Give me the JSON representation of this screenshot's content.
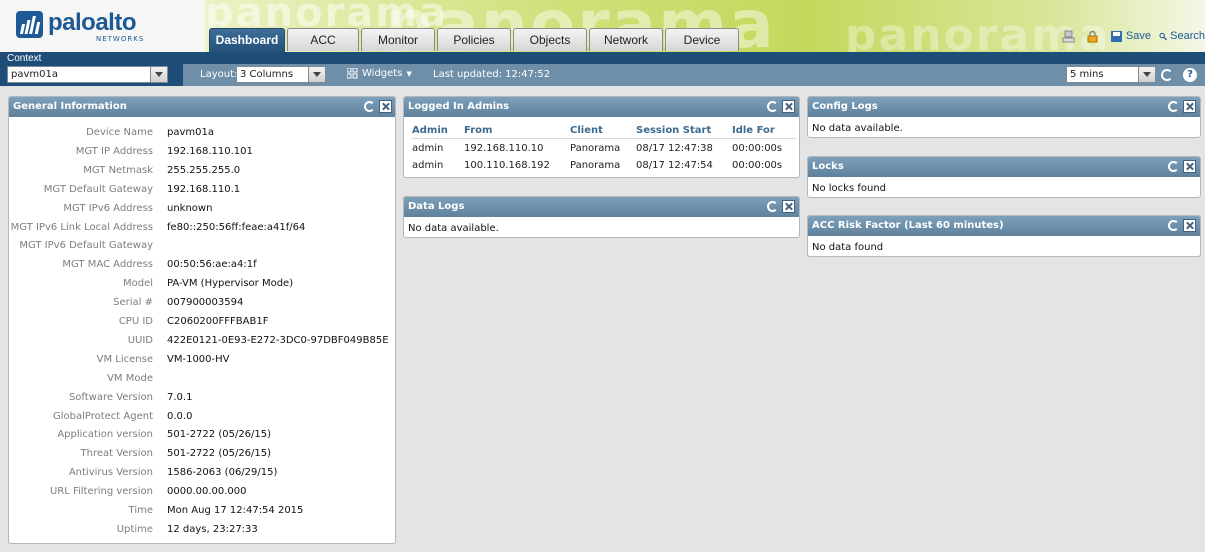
{
  "brand": {
    "name": "paloalto",
    "sub": "NETWORKS",
    "watermark": "panorama"
  },
  "tabs": [
    {
      "label": "Dashboard",
      "active": true
    },
    {
      "label": "ACC",
      "active": false
    },
    {
      "label": "Monitor",
      "active": false
    },
    {
      "label": "Policies",
      "active": false
    },
    {
      "label": "Objects",
      "active": false
    },
    {
      "label": "Network",
      "active": false
    },
    {
      "label": "Device",
      "active": false
    }
  ],
  "header_actions": {
    "save_label": "Save",
    "search_label": "Search"
  },
  "context": {
    "label": "Context",
    "value": "pavm01a"
  },
  "toolbar": {
    "layout_label": "Layout:",
    "layout_value": "3 Columns",
    "widgets_label": "Widgets",
    "last_updated": "Last updated: 12:47:52",
    "refresh_interval": "5 mins"
  },
  "general_info": {
    "title": "General Information",
    "rows": [
      {
        "label": "Device Name",
        "value": "pavm01a"
      },
      {
        "label": "MGT IP Address",
        "value": "192.168.110.101"
      },
      {
        "label": "MGT Netmask",
        "value": "255.255.255.0"
      },
      {
        "label": "MGT Default Gateway",
        "value": "192.168.110.1"
      },
      {
        "label": "MGT IPv6 Address",
        "value": "unknown"
      },
      {
        "label": "MGT IPv6 Link Local Address",
        "value": "fe80::250:56ff:feae:a41f/64"
      },
      {
        "label": "MGT IPv6 Default Gateway",
        "value": ""
      },
      {
        "label": "MGT MAC Address",
        "value": "00:50:56:ae:a4:1f"
      },
      {
        "label": "Model",
        "value": "PA-VM (Hypervisor Mode)"
      },
      {
        "label": "Serial #",
        "value": "007900003594"
      },
      {
        "label": "CPU ID",
        "value": "C2060200FFFBAB1F"
      },
      {
        "label": "UUID",
        "value": "422E0121-0E93-E272-3DC0-97DBF049B85E"
      },
      {
        "label": "VM License",
        "value": "VM-1000-HV"
      },
      {
        "label": "VM Mode",
        "value": ""
      },
      {
        "label": "Software Version",
        "value": "7.0.1"
      },
      {
        "label": "GlobalProtect Agent",
        "value": "0.0.0"
      },
      {
        "label": "Application version",
        "value": "501-2722 (05/26/15)"
      },
      {
        "label": "Threat Version",
        "value": "501-2722 (05/26/15)"
      },
      {
        "label": "Antivirus Version",
        "value": "1586-2063 (06/29/15)"
      },
      {
        "label": "URL Filtering version",
        "value": "0000.00.00.000"
      },
      {
        "label": "Time",
        "value": "Mon Aug 17 12:47:54 2015"
      },
      {
        "label": "Uptime",
        "value": "12 days, 23:27:33"
      }
    ]
  },
  "logged_in_admins": {
    "title": "Logged In Admins",
    "columns": [
      "Admin",
      "From",
      "Client",
      "Session Start",
      "Idle For"
    ],
    "rows": [
      [
        "admin",
        "192.168.110.10",
        "Panorama",
        "08/17 12:47:38",
        "00:00:00s"
      ],
      [
        "admin",
        "100.110.168.192",
        "Panorama",
        "08/17 12:47:54",
        "00:00:00s"
      ]
    ]
  },
  "data_logs": {
    "title": "Data Logs",
    "body": "No data available."
  },
  "config_logs": {
    "title": "Config Logs",
    "body": "No data available."
  },
  "locks": {
    "title": "Locks",
    "body": "No locks found"
  },
  "acc_risk": {
    "title": "ACC Risk Factor (Last 60 minutes)",
    "body": "No data found"
  }
}
